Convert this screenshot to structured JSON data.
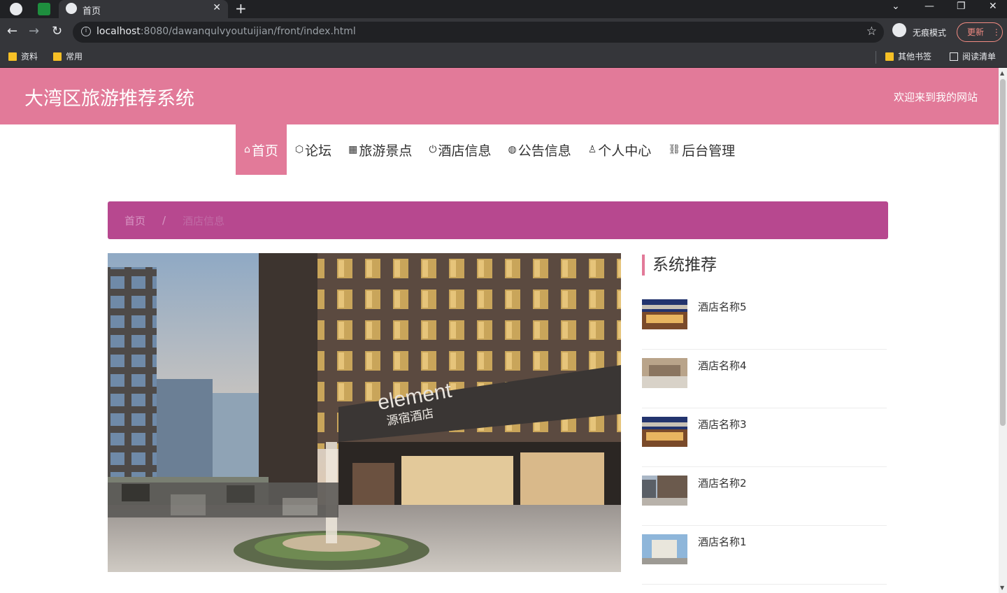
{
  "browser": {
    "tab_title": "首页",
    "url_host": "localhost",
    "url_rest": ":8080/dawanqulvyoutuijian/front/index.html",
    "incognito_label": "无痕模式",
    "update_label": "更新",
    "bookmarks": [
      "资料",
      "常用"
    ],
    "other_bookmarks": "其他书签",
    "reading_list": "阅读清单"
  },
  "header": {
    "site_title": "大湾区旅游推荐系统",
    "welcome": "欢迎来到我的网站"
  },
  "nav": {
    "items": [
      {
        "label": "首页",
        "icon": "home-icon"
      },
      {
        "label": "论坛",
        "icon": "cube-icon"
      },
      {
        "label": "旅游景点",
        "icon": "gift-icon"
      },
      {
        "label": "酒店信息",
        "icon": "power-icon"
      },
      {
        "label": "公告信息",
        "icon": "globe-icon"
      },
      {
        "label": "个人中心",
        "icon": "user-icon"
      },
      {
        "label": "后台管理",
        "icon": "link-icon"
      }
    ]
  },
  "breadcrumb": {
    "home": "首页",
    "separator": "/",
    "current": "酒店信息"
  },
  "hero": {
    "sign_en": "element",
    "sign_cn": "源宿酒店"
  },
  "sidebar": {
    "title": "系统推荐",
    "items": [
      {
        "name": "酒店名称5"
      },
      {
        "name": "酒店名称4"
      },
      {
        "name": "酒店名称3"
      },
      {
        "name": "酒店名称2"
      },
      {
        "name": "酒店名称1"
      }
    ]
  },
  "colors": {
    "header_pink": "#e27a99",
    "breadcrumb_magenta": "#b7488f",
    "chrome_dark": "#202124"
  }
}
